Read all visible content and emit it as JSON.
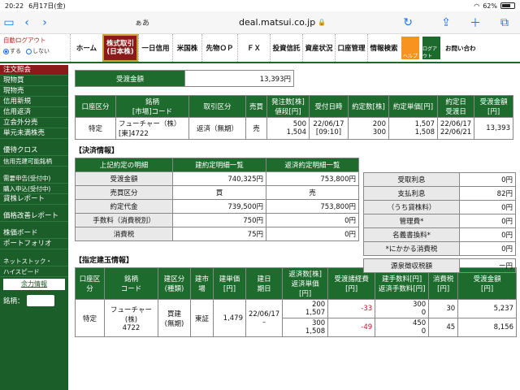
{
  "status": {
    "time": "20:22",
    "date": "6月17日(金)",
    "battery": "62%",
    "battery_level": 0.62
  },
  "browser": {
    "aa": "ぁあ",
    "url": "deal.matsui.co.jp"
  },
  "header": {
    "autologout": "自動ログアウト",
    "radio_on": "する",
    "radio_off": "しない",
    "menu": [
      "ホーム",
      "株式取引",
      "(日本株)",
      "一日信用",
      "米国株",
      "先物ＯＰ",
      "ＦＸ",
      "投資信託",
      "資産状況",
      "口座管理",
      "情報検索"
    ],
    "help": "ヘルプ",
    "logout": "ログアウト",
    "contact": "お問い合わ"
  },
  "sidebar": {
    "items": [
      "注文照会",
      "現物買",
      "現物売",
      "信用新規",
      "信用返済",
      "立会外分売",
      "単元未満株売"
    ],
    "items2": [
      "優待クロス",
      "信用売建可能銘柄"
    ],
    "items3": [
      "需要申告(受付中)",
      "購入申込(受付中)",
      "貸株レポート"
    ],
    "items4": [
      "価格改善レポート"
    ],
    "items5": [
      "株価ボード",
      "ポートフォリオ"
    ],
    "items6": [
      "ネットストック・",
      "ハイスピード"
    ],
    "yoryoku": "余力情報",
    "meigara": "銘柄："
  },
  "amount": {
    "label": "受渡金額",
    "value": "13,393円"
  },
  "order": {
    "headers": [
      "口座区分",
      "銘柄",
      "[市場]コード",
      "取引区分",
      "売買",
      "発注数[株]",
      "値段[円]",
      "受付日時",
      "約定数[株]",
      "約定単価[円]",
      "約定日",
      "受渡日",
      "受渡金額[円]"
    ],
    "row": {
      "account": "特定",
      "name": "フューチャー（株）",
      "code": "[東]4722",
      "type": "返済（無期）",
      "side": "売",
      "qty1": "500",
      "qty2": "1,504",
      "date": "22/06/17",
      "time": "[09:10]",
      "fill1": "200",
      "fill2": "300",
      "price1": "1,507",
      "price2": "1,508",
      "d1": "22/06/17",
      "d2": "22/06/21",
      "total": "13,393"
    }
  },
  "settle": {
    "title": "【決済情報】",
    "headers": [
      "上記約定の明細",
      "建約定明細一覧",
      "返済約定明細一覧"
    ],
    "rows": [
      {
        "label": "受渡金額",
        "a": "740,325円",
        "b": "753,800円"
      },
      {
        "label": "売買区分",
        "a": "買",
        "b": "売"
      },
      {
        "label": "約定代金",
        "a": "739,500円",
        "b": "753,800円"
      },
      {
        "label": "手数料（消費税別）",
        "a": "750円",
        "b": "0円"
      },
      {
        "label": "消費税",
        "a": "75円",
        "b": "0円"
      }
    ],
    "right": [
      {
        "label": "受取利息",
        "v": "0円"
      },
      {
        "label": "支払利息",
        "v": "82円"
      },
      {
        "label": "（うち貸株料）",
        "v": "0円"
      },
      {
        "label": "管理費*",
        "v": "0円"
      },
      {
        "label": "名義書換料*",
        "v": "0円"
      },
      {
        "label": "*にかかる消費税",
        "v": "0円"
      }
    ],
    "gensen_label": "源泉徴収税額",
    "gensen_value": "ー円"
  },
  "position": {
    "title": "【指定建玉情報】",
    "headers": [
      "口座区分",
      "銘柄",
      "コード",
      "建区分",
      "(種類)",
      "建市",
      "場",
      "建単価",
      "[円]",
      "建日",
      "期日",
      "返済数[株]",
      "返済単価[円]",
      "受渡諸経費",
      "[円]",
      "建手数料[円]",
      "返済手数料[円]",
      "消費税",
      "[円]",
      "受渡金額",
      "[円]"
    ],
    "row": {
      "account": "特定",
      "name": "フューチャー",
      "name2": "(株)",
      "code": "4722",
      "kind": "買建",
      "kind2": "(無期)",
      "market": "東証",
      "price": "1,479",
      "date": "22/06/17",
      "limit": "–",
      "q1": "200",
      "p1": "1,507",
      "q2": "300",
      "p2": "1,508",
      "cost1": "-33",
      "cost2": "-49",
      "fee1a": "300",
      "fee1b": "0",
      "fee2a": "450",
      "fee2b": "0",
      "tax1": "30",
      "tax2": "45",
      "tot1": "5,237",
      "tot2": "8,156"
    }
  }
}
